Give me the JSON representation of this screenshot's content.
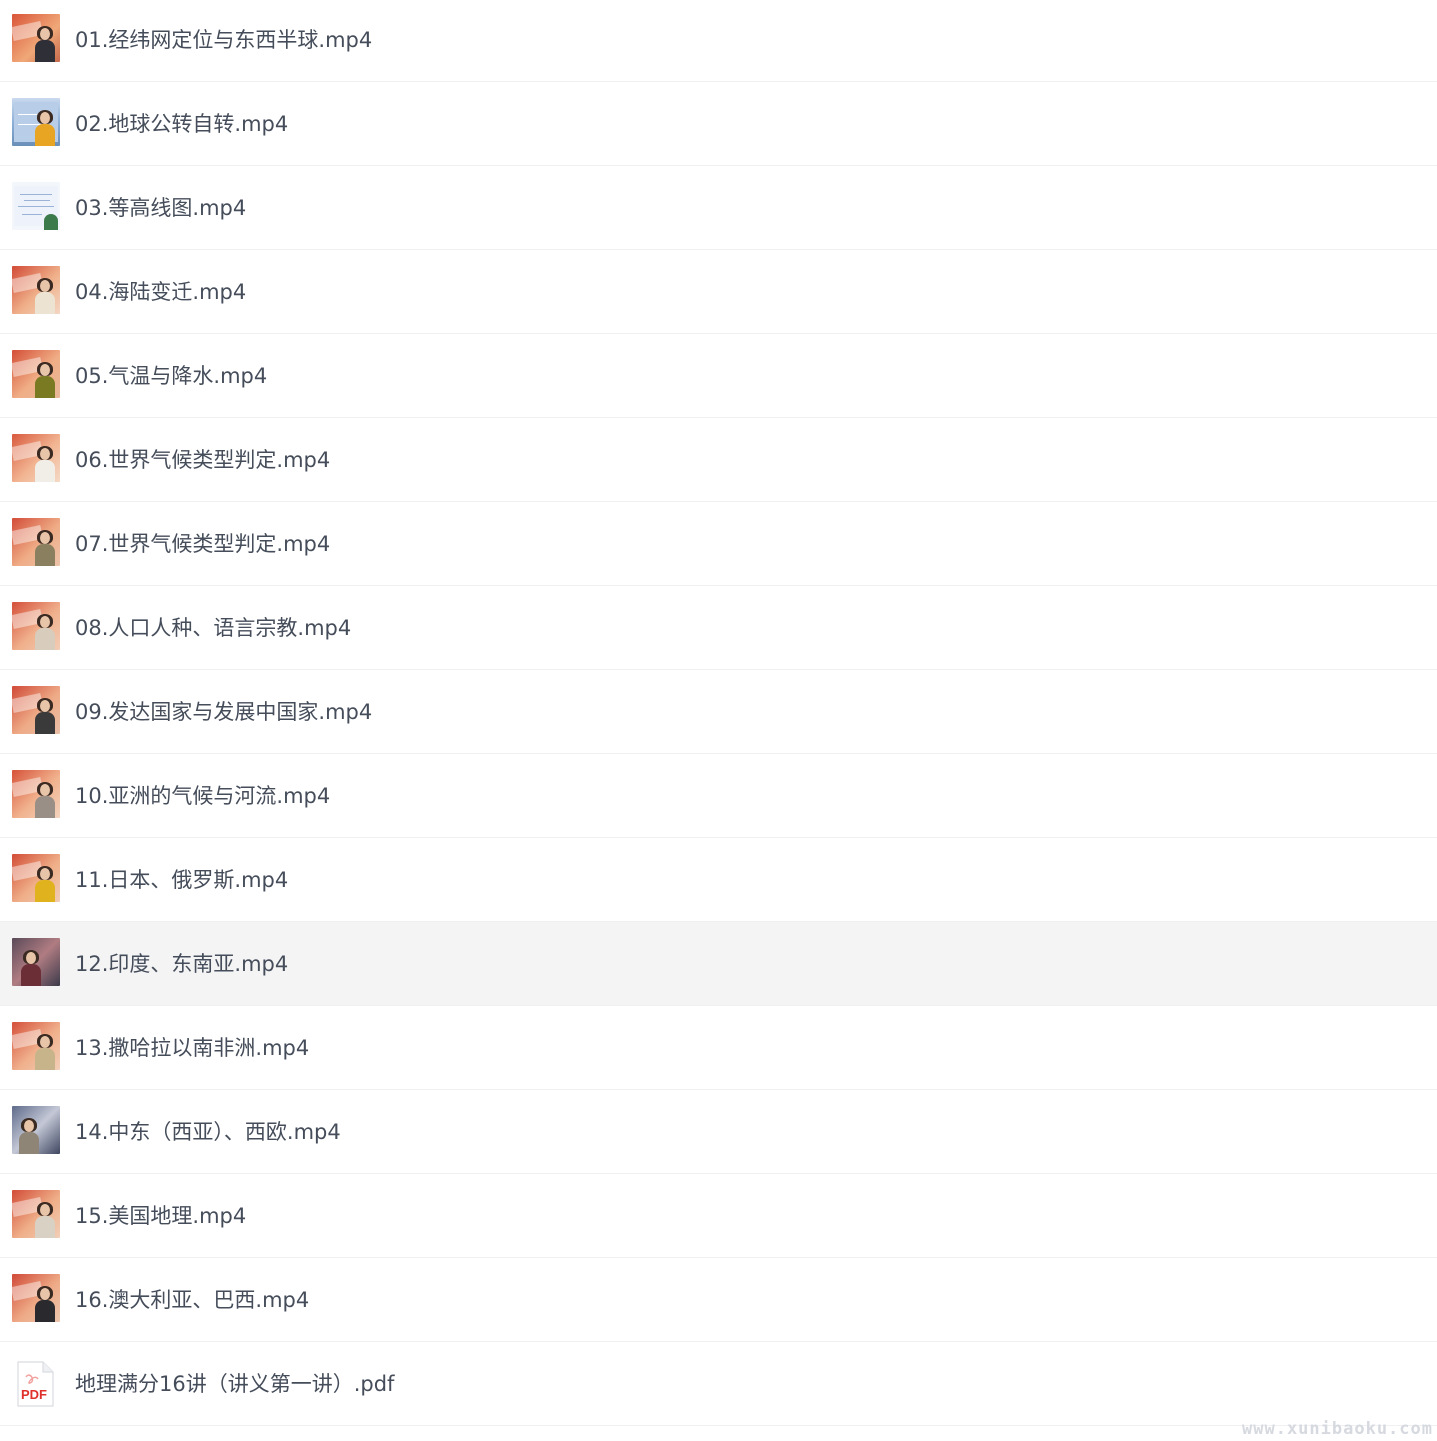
{
  "files": [
    {
      "name": "01.经纬网定位与东西半球.mp4",
      "thumb": "lecture-video-thumbnail-icon"
    },
    {
      "name": "02.地球公转自转.mp4",
      "thumb": "lecture-video-thumbnail-icon"
    },
    {
      "name": "03.等高线图.mp4",
      "thumb": "lecture-video-thumbnail-icon"
    },
    {
      "name": "04.海陆变迁.mp4",
      "thumb": "lecture-video-thumbnail-icon"
    },
    {
      "name": "05.气温与降水.mp4",
      "thumb": "lecture-video-thumbnail-icon"
    },
    {
      "name": "06.世界气候类型判定.mp4",
      "thumb": "lecture-video-thumbnail-icon"
    },
    {
      "name": "07.世界气候类型判定.mp4",
      "thumb": "lecture-video-thumbnail-icon"
    },
    {
      "name": "08.人口人种、语言宗教.mp4",
      "thumb": "lecture-video-thumbnail-icon"
    },
    {
      "name": "09.发达国家与发展中国家.mp4",
      "thumb": "lecture-video-thumbnail-icon"
    },
    {
      "name": "10.亚洲的气候与河流.mp4",
      "thumb": "lecture-video-thumbnail-icon"
    },
    {
      "name": "11.日本、俄罗斯.mp4",
      "thumb": "lecture-video-thumbnail-icon"
    },
    {
      "name": "12.印度、东南亚.mp4",
      "thumb": "lecture-video-thumbnail-icon",
      "selected": true
    },
    {
      "name": "13.撒哈拉以南非洲.mp4",
      "thumb": "lecture-video-thumbnail-icon"
    },
    {
      "name": "14.中东（西亚）、西欧.mp4",
      "thumb": "lecture-video-thumbnail-icon"
    },
    {
      "name": "15.美国地理.mp4",
      "thumb": "lecture-video-thumbnail-icon"
    },
    {
      "name": "16.澳大利亚、巴西.mp4",
      "thumb": "lecture-video-thumbnail-icon"
    },
    {
      "name": "地理满分16讲（讲义第一讲）.pdf",
      "thumb": "pdf-file-icon"
    }
  ],
  "pdf_icon_label": "PDF",
  "watermark": "www.xunibaoku.com",
  "colors": {
    "text": "#454d5a",
    "row_divider": "#f0f0f2",
    "selected_row": "#f4f4f5",
    "pdf_red": "#e0302b"
  }
}
